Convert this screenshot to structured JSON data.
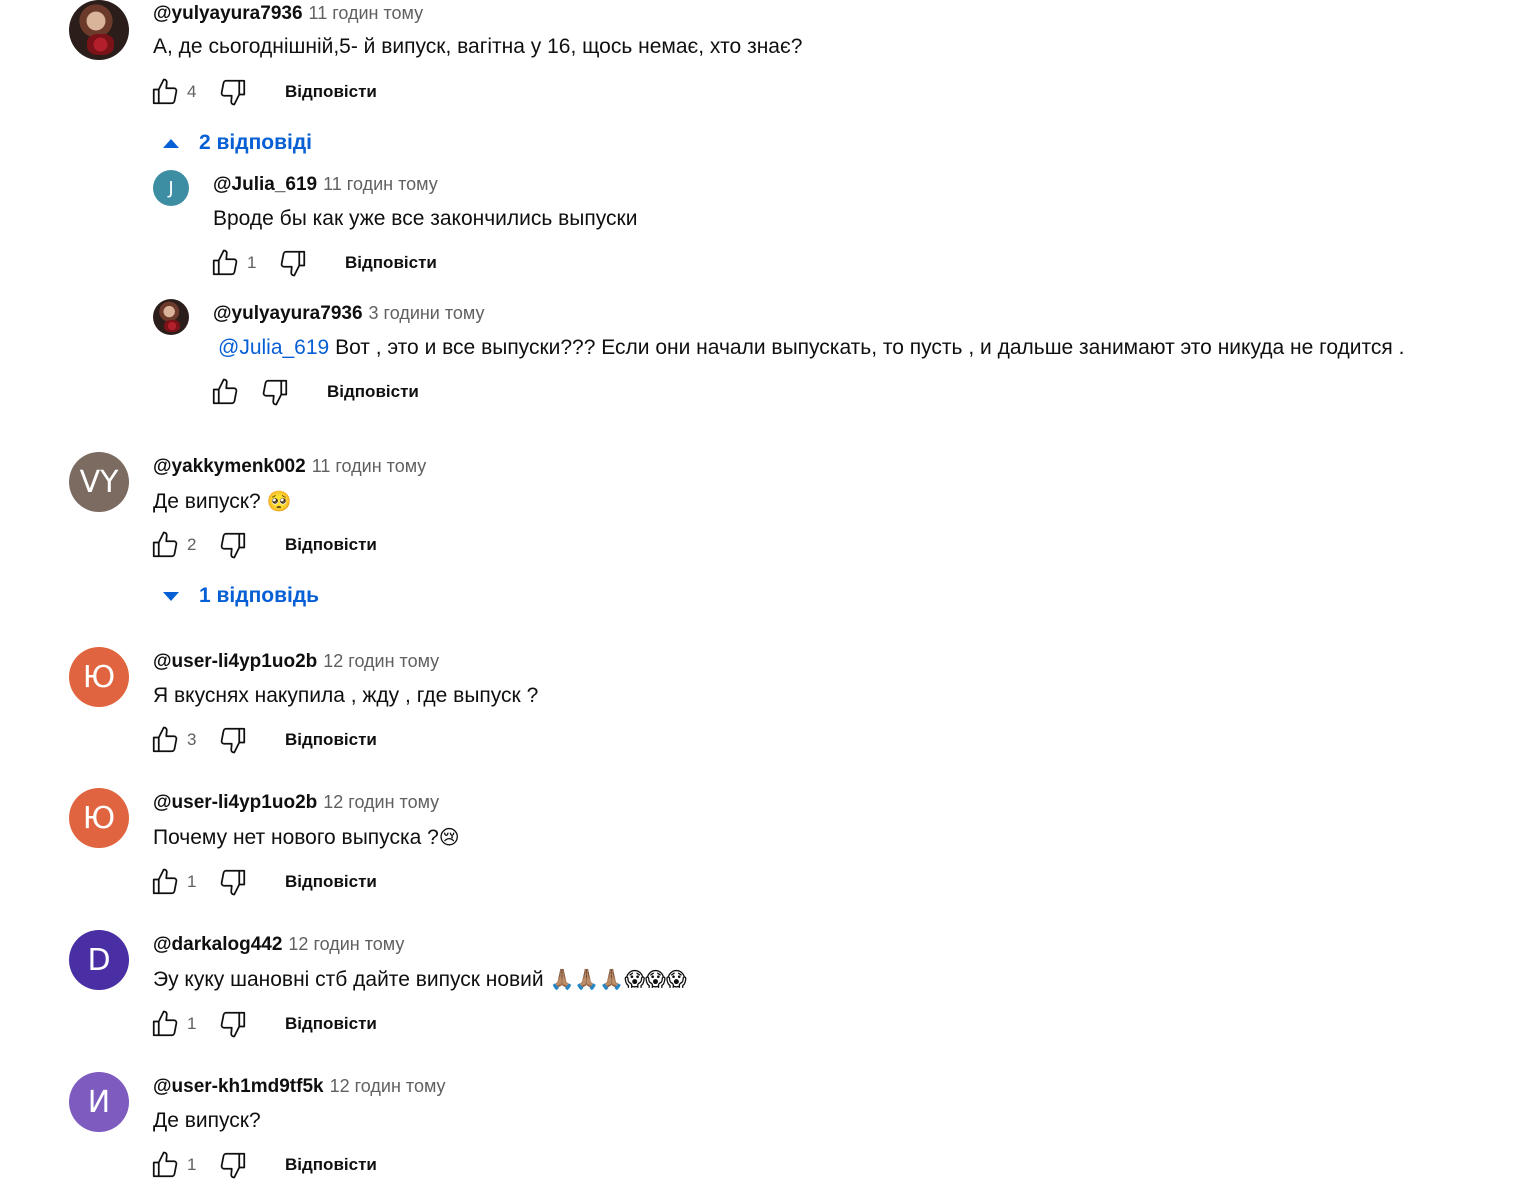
{
  "comments": [
    {
      "author": "@yulyayura7936",
      "time": "11 годин тому",
      "text": "А, де сьогоднішній,5- й випуск, вагітна у 16, щось немає, хто знає?",
      "likes": "4",
      "reply_label": "Відповісти",
      "replies_toggle": "2 відповіді",
      "replies": [
        {
          "avatar_letter": "J",
          "avatar_color": "#3d8ea3",
          "author": "@Julia_619",
          "time": "11 годин тому",
          "text": "Вроде бы как уже все закончились выпуски",
          "likes": "1",
          "reply_label": "Відповісти"
        },
        {
          "author": "@yulyayura7936",
          "time": "3 години тому",
          "mention": "@Julia_619",
          "text": " Вот , это и все  выпуски??? Если они начали выпускать, то пусть , и дальше занимают это никуда не годится .",
          "likes": "",
          "reply_label": "Відповісти"
        }
      ]
    },
    {
      "avatar_letter": "VY",
      "avatar_color": "#7c6b61",
      "author": "@yakkymenk002",
      "time": "11 годин тому",
      "text": "Де випуск? ",
      "emoji": "🥺",
      "likes": "2",
      "reply_label": "Відповісти",
      "replies_toggle": "1 відповідь"
    },
    {
      "avatar_letter": "Ю",
      "avatar_color": "#e0643f",
      "author": "@user-li4yp1uo2b",
      "time": "12 годин тому",
      "text": "Я вкуснях накупила , жду , где выпуск ?",
      "likes": "3",
      "reply_label": "Відповісти"
    },
    {
      "avatar_letter": "Ю",
      "avatar_color": "#e0643f",
      "author": "@user-li4yp1uo2b",
      "time": "12 годин тому",
      "text": "Почему нет нового выпуска ?",
      "emoji": "😢",
      "likes": "1",
      "reply_label": "Відповісти"
    },
    {
      "avatar_letter": "D",
      "avatar_color": "#4a2ea3",
      "author": "@darkalog442",
      "time": "12 годин тому",
      "text": "Эу куку шановні стб дайте випуск новий  ",
      "emoji": "🙏🏽🙏🏽🙏🏽😱😱😱",
      "likes": "1",
      "reply_label": "Відповісти"
    },
    {
      "avatar_letter": "И",
      "avatar_color": "#7d5bbf",
      "author": "@user-kh1md9tf5k",
      "time": "12 годин тому",
      "text": "Де випуск?",
      "likes": "1",
      "reply_label": "Відповісти"
    }
  ]
}
